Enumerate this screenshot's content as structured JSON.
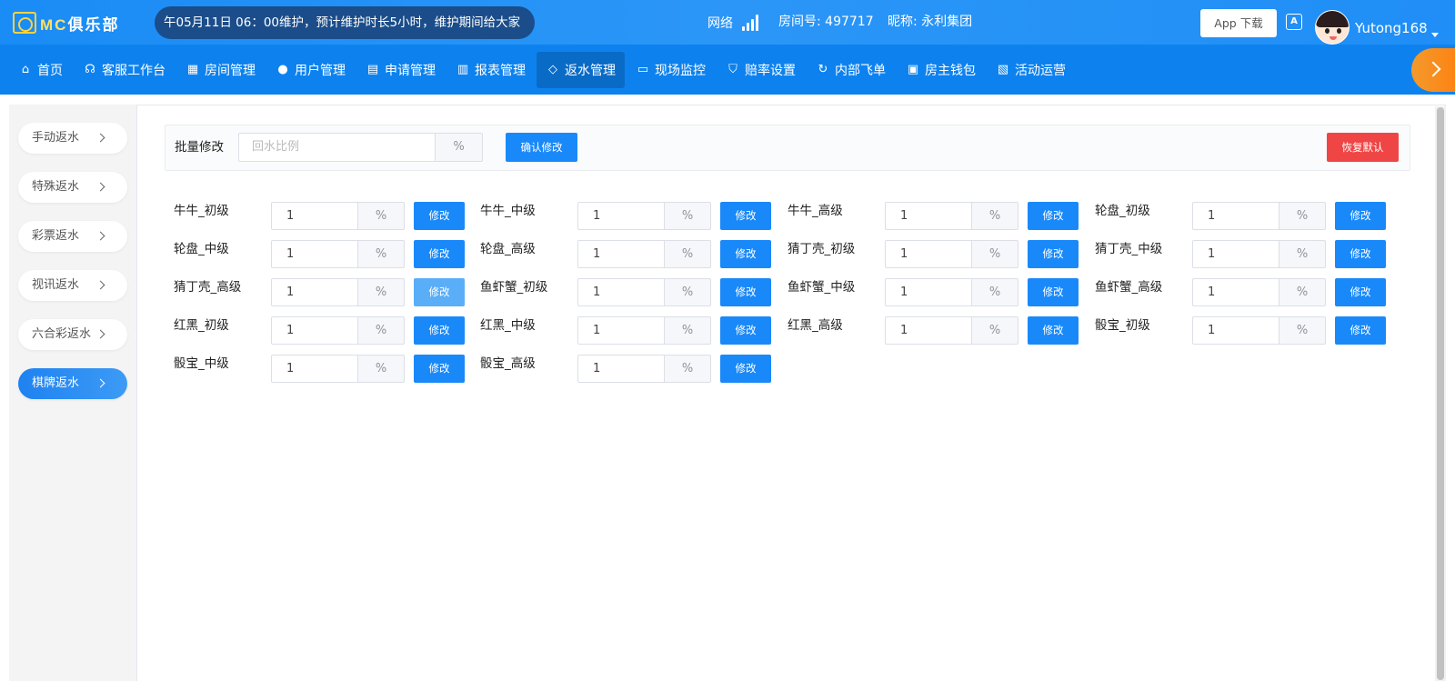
{
  "header": {
    "logo_text": "MC",
    "logo_cn": "俱乐部",
    "notice": "午05月11日 06：00维护，预计维护时长5小时，维护期间给大家",
    "network_label": "网络",
    "room_label": "房间号: 497717",
    "nickname_label": "昵称: 永利集团",
    "app_download": "App 下载",
    "username": "Yutong168"
  },
  "nav": [
    {
      "label": "首页",
      "icon": "home-icon",
      "glyph": "⌂"
    },
    {
      "label": "客服工作台",
      "icon": "headset-icon",
      "glyph": "☊"
    },
    {
      "label": "房间管理",
      "icon": "grid-icon",
      "glyph": "▦"
    },
    {
      "label": "用户管理",
      "icon": "user-icon",
      "glyph": "●"
    },
    {
      "label": "申请管理",
      "icon": "document-icon",
      "glyph": "▤"
    },
    {
      "label": "报表管理",
      "icon": "bar-chart-icon",
      "glyph": "▥"
    },
    {
      "label": "返水管理",
      "icon": "tag-icon",
      "glyph": "◇",
      "active": true
    },
    {
      "label": "现场监控",
      "icon": "monitor-icon",
      "glyph": "▭"
    },
    {
      "label": "赔率设置",
      "icon": "shield-icon",
      "glyph": "⛉"
    },
    {
      "label": "内部飞单",
      "icon": "refresh-icon",
      "glyph": "↻"
    },
    {
      "label": "房主钱包",
      "icon": "wallet-icon",
      "glyph": "▣"
    },
    {
      "label": "活动运营",
      "icon": "clipboard-icon",
      "glyph": "▧"
    }
  ],
  "sidebar": [
    {
      "label": "手动返水"
    },
    {
      "label": "特殊返水"
    },
    {
      "label": "彩票返水"
    },
    {
      "label": "视讯返水"
    },
    {
      "label": "六合彩返水"
    },
    {
      "label": "棋牌返水",
      "active": true
    }
  ],
  "batch": {
    "label": "批量修改",
    "placeholder": "回水比例",
    "unit": "%",
    "confirm": "确认修改",
    "reset": "恢复默认"
  },
  "rates": [
    {
      "label": "牛牛_初级",
      "value": "1",
      "unit": "%",
      "button": "修改"
    },
    {
      "label": "牛牛_中级",
      "value": "1",
      "unit": "%",
      "button": "修改"
    },
    {
      "label": "牛牛_高级",
      "value": "1",
      "unit": "%",
      "button": "修改"
    },
    {
      "label": "轮盘_初级",
      "value": "1",
      "unit": "%",
      "button": "修改"
    },
    {
      "label": "轮盘_中级",
      "value": "1",
      "unit": "%",
      "button": "修改"
    },
    {
      "label": "轮盘_高级",
      "value": "1",
      "unit": "%",
      "button": "修改"
    },
    {
      "label": "猜丁壳_初级",
      "value": "1",
      "unit": "%",
      "button": "修改"
    },
    {
      "label": "猜丁壳_中级",
      "value": "1",
      "unit": "%",
      "button": "修改"
    },
    {
      "label": "猜丁壳_高级",
      "value": "1",
      "unit": "%",
      "button": "修改",
      "hover": true
    },
    {
      "label": "鱼虾蟹_初级",
      "value": "1",
      "unit": "%",
      "button": "修改"
    },
    {
      "label": "鱼虾蟹_中级",
      "value": "1",
      "unit": "%",
      "button": "修改"
    },
    {
      "label": "鱼虾蟹_高级",
      "value": "1",
      "unit": "%",
      "button": "修改"
    },
    {
      "label": "红黑_初级",
      "value": "1",
      "unit": "%",
      "button": "修改"
    },
    {
      "label": "红黑_中级",
      "value": "1",
      "unit": "%",
      "button": "修改"
    },
    {
      "label": "红黑_高级",
      "value": "1",
      "unit": "%",
      "button": "修改"
    },
    {
      "label": "骰宝_初级",
      "value": "1",
      "unit": "%",
      "button": "修改"
    },
    {
      "label": "骰宝_中级",
      "value": "1",
      "unit": "%",
      "button": "修改"
    },
    {
      "label": "骰宝_高级",
      "value": "1",
      "unit": "%",
      "button": "修改"
    }
  ],
  "colors": {
    "primary": "#1989fa",
    "nav_bg": "#0d82ef",
    "danger": "#f04545",
    "accent_orange": "#ff7f0f"
  }
}
